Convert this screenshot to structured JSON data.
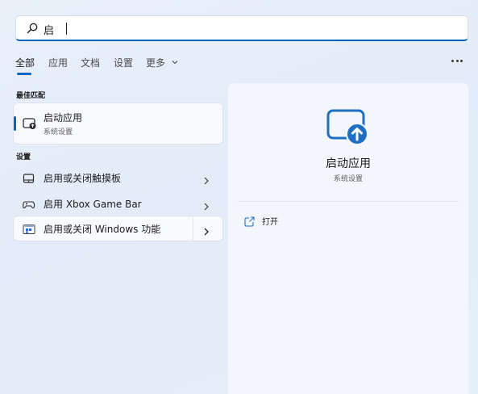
{
  "search": {
    "query": "启"
  },
  "filters": {
    "items": [
      {
        "label": "全部",
        "active": true
      },
      {
        "label": "应用"
      },
      {
        "label": "文档"
      },
      {
        "label": "设置"
      },
      {
        "label": "更多"
      }
    ]
  },
  "best_match": {
    "heading": "最佳匹配",
    "title": "启动应用",
    "subtitle": "系统设置",
    "icon": "startup-apps-icon"
  },
  "settings_section": {
    "heading": "设置",
    "items": [
      {
        "label": "启用或关闭触摸板",
        "icon": "touchpad-icon"
      },
      {
        "label": "启用 Xbox Game Bar",
        "icon": "game-bar-icon"
      },
      {
        "label": "启用或关闭 Windows 功能",
        "icon": "windows-features-icon"
      }
    ]
  },
  "preview": {
    "title": "启动应用",
    "subtitle": "系统设置",
    "icon": "startup-apps-icon",
    "actions": [
      {
        "label": "打开",
        "icon": "open-external-icon"
      }
    ]
  },
  "colors": {
    "accent": "#0067c0",
    "background": "#e6eef9",
    "card": "#f8fafd"
  }
}
